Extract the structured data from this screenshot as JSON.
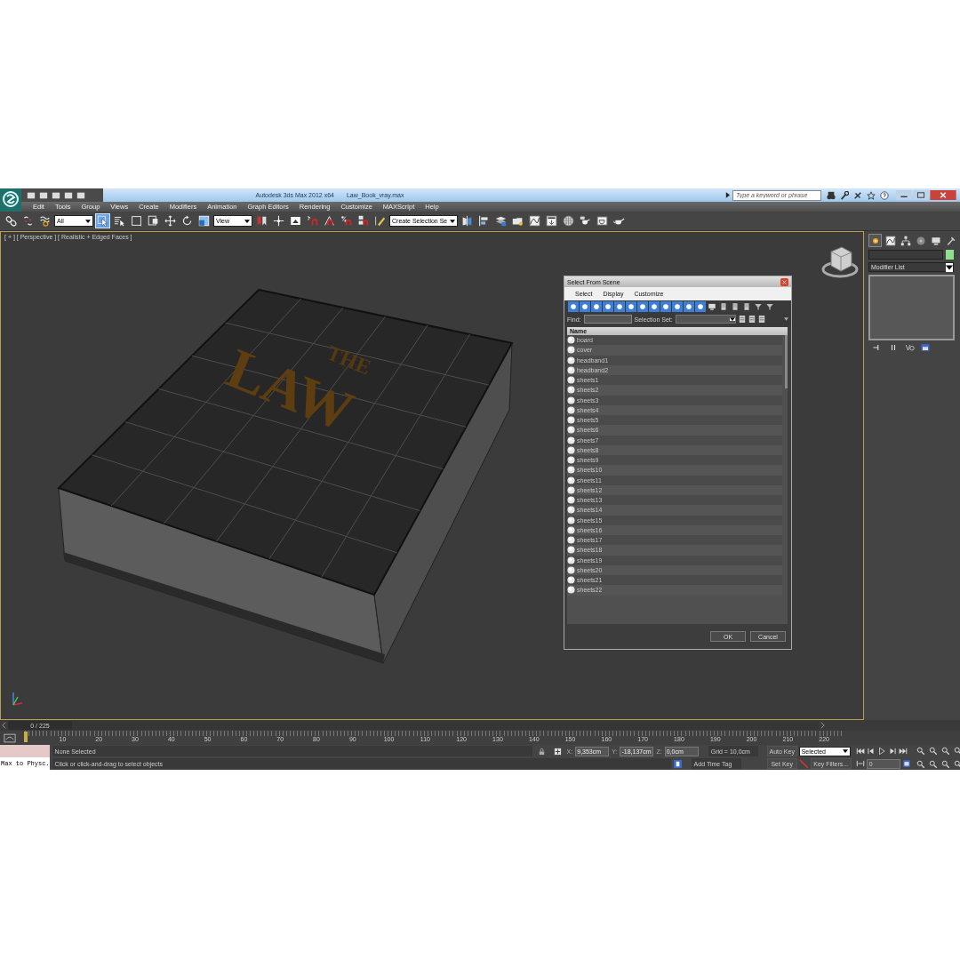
{
  "window": {
    "title": "Autodesk 3ds Max 2012 x64",
    "file": "Law_Book_vray.max"
  },
  "search": {
    "placeholder": "Type a keyword or phrase"
  },
  "menu": [
    "Edit",
    "Tools",
    "Group",
    "Views",
    "Create",
    "Modifiers",
    "Animation",
    "Graph Editors",
    "Rendering",
    "Customize",
    "MAXScript",
    "Help"
  ],
  "toolbar": [
    {
      "kind": "link",
      "selected": false
    },
    {
      "kind": "unlink",
      "selected": false
    },
    {
      "kind": "wave",
      "selected": false
    },
    {
      "kind": "dropdown",
      "value": "All"
    },
    {
      "kind": "select",
      "selected": true
    },
    {
      "kind": "list",
      "selected": false
    },
    {
      "kind": "rect",
      "selected": false
    },
    {
      "kind": "window",
      "selected": false
    },
    {
      "kind": "move",
      "selected": false
    },
    {
      "kind": "rotate",
      "selected": false
    },
    {
      "kind": "scale",
      "selected": false
    },
    {
      "kind": "dropdown",
      "value": "View"
    },
    {
      "kind": "pivot",
      "selected": false
    },
    {
      "kind": "cross",
      "selected": false
    },
    {
      "kind": "keyboard",
      "selected": false
    },
    {
      "kind": "snap",
      "selected": false
    },
    {
      "kind": "angle",
      "selected": false
    },
    {
      "kind": "percent",
      "selected": false
    },
    {
      "kind": "spinner",
      "selected": false
    },
    {
      "kind": "pencil",
      "selected": false
    },
    {
      "kind": "dropdown",
      "value": "Create Selection Se"
    },
    {
      "kind": "mirror",
      "selected": false
    },
    {
      "kind": "align",
      "selected": false
    },
    {
      "kind": "layers",
      "selected": false
    },
    {
      "kind": "folder",
      "selected": false
    },
    {
      "kind": "curve",
      "selected": false
    },
    {
      "kind": "schematic",
      "selected": false
    },
    {
      "kind": "material",
      "selected": false
    },
    {
      "kind": "teapot",
      "selected": false
    },
    {
      "kind": "frame",
      "selected": false
    },
    {
      "kind": "render",
      "selected": false
    }
  ],
  "viewport": {
    "label": "[ + ] [ Perspective ] [ Realistic + Edged Faces ]",
    "model_texts": [
      "THE",
      "LAW"
    ]
  },
  "dialog": {
    "title": "Select From Scene",
    "menu": [
      "Select",
      "Display",
      "Customize"
    ],
    "toolbar": [
      {
        "kind": "filter",
        "selected": true
      },
      {
        "kind": "filter",
        "selected": true
      },
      {
        "kind": "filter",
        "selected": true
      },
      {
        "kind": "filter",
        "selected": true
      },
      {
        "kind": "filter",
        "selected": true
      },
      {
        "kind": "filter",
        "selected": true
      },
      {
        "kind": "filter",
        "selected": true
      },
      {
        "kind": "filter",
        "selected": true
      },
      {
        "kind": "filter",
        "selected": true
      },
      {
        "kind": "filter",
        "selected": true
      },
      {
        "kind": "filter",
        "selected": true
      },
      {
        "kind": "filter",
        "selected": true
      },
      {
        "kind": "display",
        "selected": false
      },
      {
        "kind": "column",
        "selected": false
      },
      {
        "kind": "column",
        "selected": false
      },
      {
        "kind": "column",
        "selected": false
      },
      {
        "kind": "funnel",
        "selected": false
      },
      {
        "kind": "funnel",
        "selected": false
      }
    ],
    "find_label": "Find:",
    "selection_set_label": "Selection Set:",
    "column": "Name",
    "rows": [
      {
        "name": "board",
        "selected": false
      },
      {
        "name": "cover",
        "selected": false
      },
      {
        "name": "headband1",
        "selected": false
      },
      {
        "name": "headband2",
        "selected": false
      },
      {
        "name": "sheets1",
        "selected": false
      },
      {
        "name": "sheets2",
        "selected": false
      },
      {
        "name": "sheets3",
        "selected": false
      },
      {
        "name": "sheets4",
        "selected": false
      },
      {
        "name": "sheets5",
        "selected": false
      },
      {
        "name": "sheets6",
        "selected": false
      },
      {
        "name": "sheets7",
        "selected": false
      },
      {
        "name": "sheets8",
        "selected": false
      },
      {
        "name": "sheets9",
        "selected": false
      },
      {
        "name": "sheets10",
        "selected": false
      },
      {
        "name": "sheets11",
        "selected": false
      },
      {
        "name": "sheets12",
        "selected": false
      },
      {
        "name": "sheets13",
        "selected": false
      },
      {
        "name": "sheets14",
        "selected": false
      },
      {
        "name": "sheets15",
        "selected": false
      },
      {
        "name": "sheets16",
        "selected": false
      },
      {
        "name": "sheets17",
        "selected": false
      },
      {
        "name": "sheets18",
        "selected": false
      },
      {
        "name": "sheets19",
        "selected": false
      },
      {
        "name": "sheets20",
        "selected": false
      },
      {
        "name": "sheets21",
        "selected": false
      },
      {
        "name": "sheets22",
        "selected": false
      }
    ],
    "buttons": [
      "OK",
      "Cancel"
    ]
  },
  "command_panel": {
    "tabs": [
      {
        "kind": "sun",
        "selected": true
      },
      {
        "kind": "curve",
        "selected": false
      },
      {
        "kind": "hierarchy",
        "selected": false
      },
      {
        "kind": "motion",
        "selected": false
      },
      {
        "kind": "display",
        "selected": false
      },
      {
        "kind": "hammer",
        "selected": false
      }
    ],
    "modifier_list": "Modifier List"
  },
  "time_slider": {
    "label": "0 / 225",
    "level": 0
  },
  "track_labels": [
    "10",
    "20",
    "30",
    "40",
    "50",
    "60",
    "70",
    "80",
    "90",
    "100",
    "110",
    "120",
    "130",
    "140",
    "150",
    "160",
    "170",
    "180",
    "190",
    "200",
    "210",
    "220"
  ],
  "status": {
    "listener": "Max to Physc.",
    "selection": "None Selected",
    "prompt": "Click or click-and-drag to select objects",
    "coords": [
      {
        "axis": "X:",
        "value": "9,353cm"
      },
      {
        "axis": "Y:",
        "value": "-18,137cm"
      },
      {
        "axis": "Z:",
        "value": "0,0cm"
      }
    ],
    "grid": "Grid = 10,0cm",
    "time_tag": "Add Time Tag",
    "auto_key": "Auto Key",
    "key_mode": "Selected",
    "set_key": "Set Key",
    "key_filters": "Key Filters...",
    "frame": "0"
  }
}
